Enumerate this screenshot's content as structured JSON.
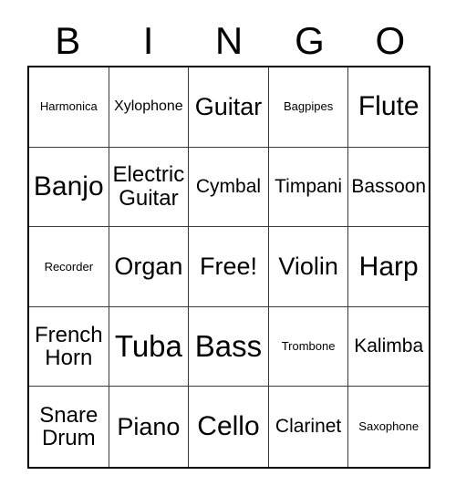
{
  "card": {
    "title_letters": [
      "B",
      "I",
      "N",
      "G",
      "O"
    ],
    "free_space_label": "Free!",
    "ink_color": "#000000",
    "background_color": "#ffffff",
    "grid_line_color": "#3a3a3a",
    "rows": 5,
    "columns": 5
  },
  "cells": [
    {
      "text": "Harmonica",
      "size": "sz-xs"
    },
    {
      "text": "Xylophone",
      "size": "sz-s"
    },
    {
      "text": "Guitar",
      "size": "sz-l"
    },
    {
      "text": "Bagpipes",
      "size": "sz-xs"
    },
    {
      "text": "Flute",
      "size": "sz-xl"
    },
    {
      "text": "Banjo",
      "size": "sz-xl"
    },
    {
      "text": "Electric\nGuitar",
      "size": "sz-ml"
    },
    {
      "text": "Cymbal",
      "size": "sz-m"
    },
    {
      "text": "Timpani",
      "size": "sz-m"
    },
    {
      "text": "Bassoon",
      "size": "sz-m"
    },
    {
      "text": "Recorder",
      "size": "sz-xs"
    },
    {
      "text": "Organ",
      "size": "sz-l"
    },
    {
      "text": "Free!",
      "size": "sz-l"
    },
    {
      "text": "Violin",
      "size": "sz-l"
    },
    {
      "text": "Harp",
      "size": "sz-xl"
    },
    {
      "text": "French\nHorn",
      "size": "sz-ml"
    },
    {
      "text": "Tuba",
      "size": "sz-xxl"
    },
    {
      "text": "Bass",
      "size": "sz-xxl"
    },
    {
      "text": "Trombone",
      "size": "sz-xs"
    },
    {
      "text": "Kalimba",
      "size": "sz-m"
    },
    {
      "text": "Snare\nDrum",
      "size": "sz-ml"
    },
    {
      "text": "Piano",
      "size": "sz-l"
    },
    {
      "text": "Cello",
      "size": "sz-xl"
    },
    {
      "text": "Clarinet",
      "size": "sz-m"
    },
    {
      "text": "Saxophone",
      "size": "sz-xs"
    }
  ]
}
